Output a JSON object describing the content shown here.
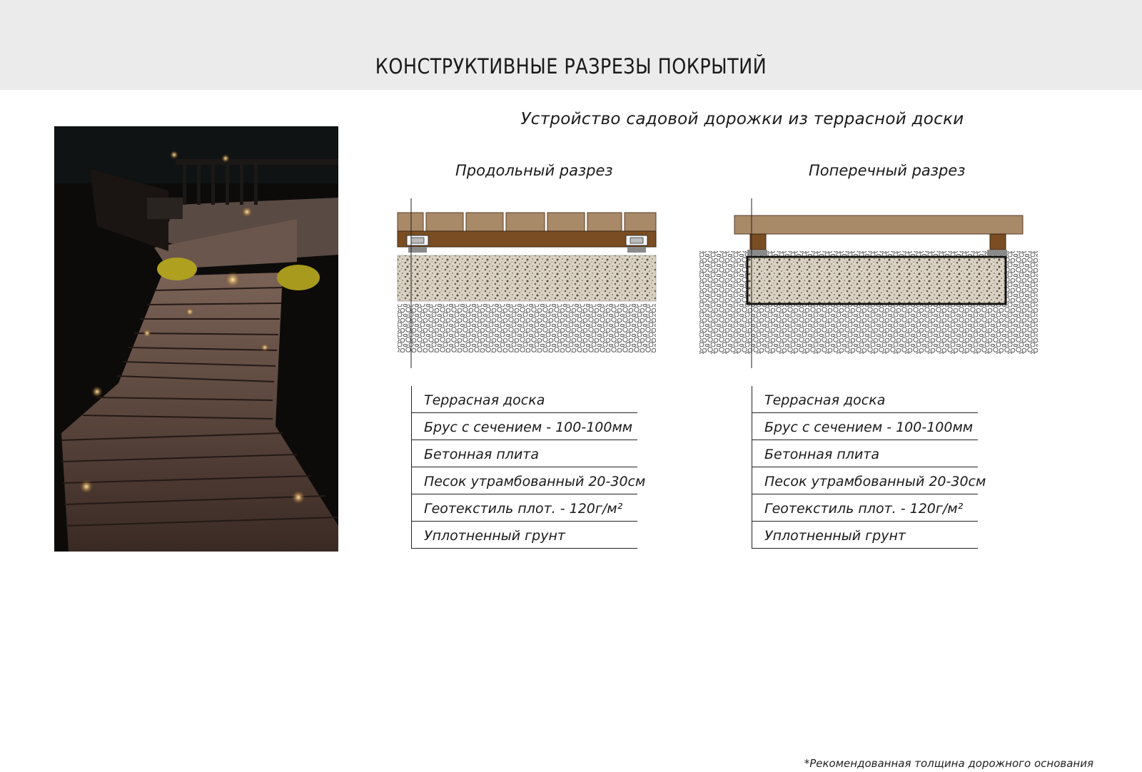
{
  "header": {
    "title": "КОНСТРУКТИВНЫЕ РАЗРЕЗЫ ПОКРЫТИЙ"
  },
  "main": {
    "subtitle": "Устройство садовой дорожки из террасной доски",
    "sections": [
      {
        "title": "Продольный разрез",
        "layers": [
          "Террасная доска",
          "Брус с сечением - 100-100мм",
          "Бетонная плита",
          "Песок утрамбованный 20-30см",
          "Геотекстиль плот. - 120г/м²",
          "Уплотненный грунт"
        ]
      },
      {
        "title": "Поперечный разрез",
        "layers": [
          "Террасная доска",
          "Брус с сечением - 100-100мм",
          "Бетонная плита",
          "Песок утрамбованный 20-30см",
          "Геотекстиль плот. - 120г/м²",
          "Уплотненный грунт"
        ]
      }
    ]
  },
  "footer": {
    "note": "*Рекомендованная толщина дорожного основания"
  },
  "colors": {
    "header_bg": "#ebebeb",
    "board_light": "#a88968",
    "beam_dark": "#7a4e22",
    "concrete_gray": "#8a8a8a"
  }
}
